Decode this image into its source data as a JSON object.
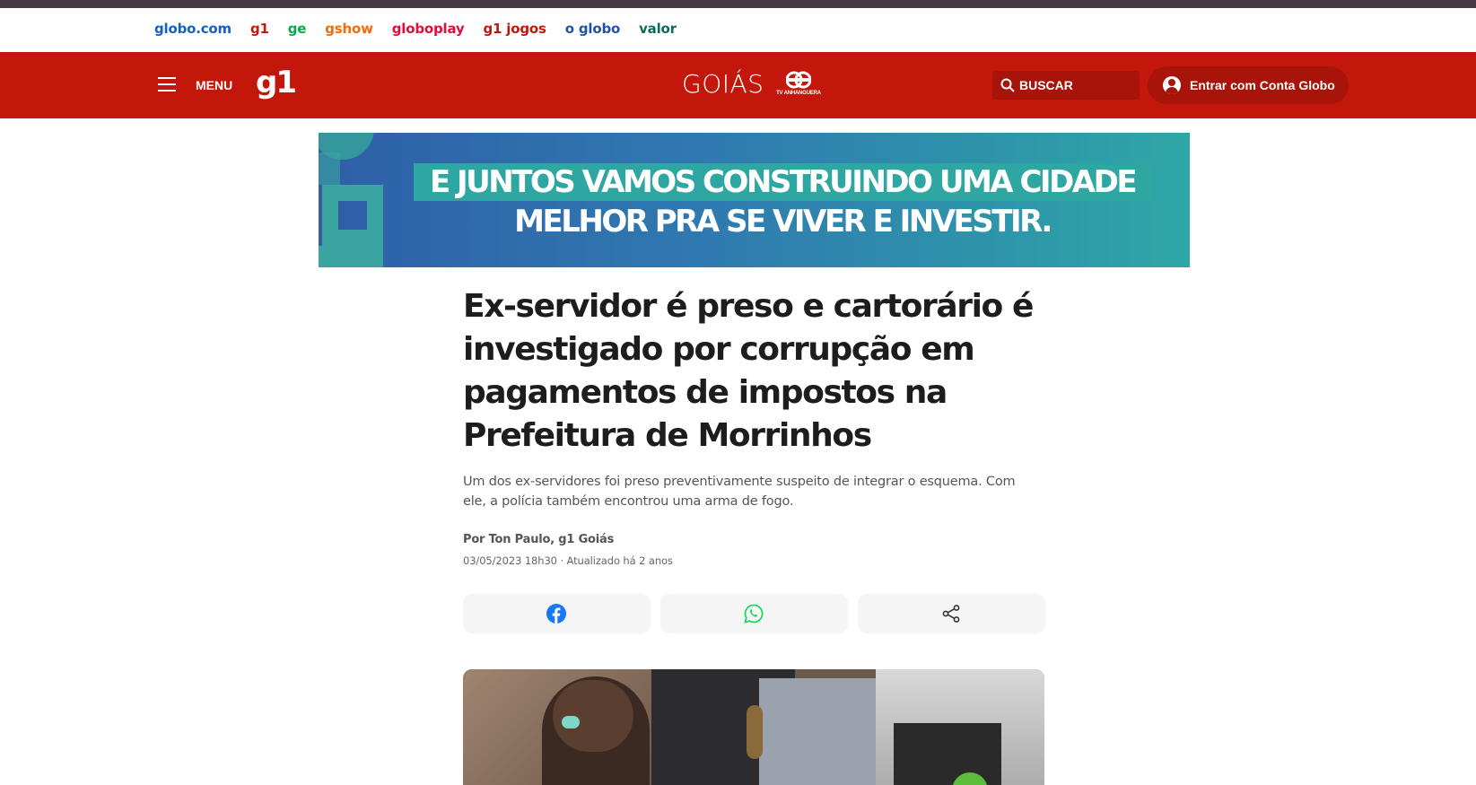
{
  "network_bar": {
    "links": [
      {
        "label": "globo.com",
        "color": "#1560c0"
      },
      {
        "label": "g1",
        "color": "#c4170c"
      },
      {
        "label": "ge",
        "color": "#06aa48"
      },
      {
        "label": "gshow",
        "color": "#f56b09"
      },
      {
        "label": "globoplay",
        "color": "#e40c3b"
      },
      {
        "label": "g1 jogos",
        "color": "#c4170c"
      },
      {
        "label": "o globo",
        "color": "#2152a3"
      },
      {
        "label": "valor",
        "color": "#0f6a5a"
      }
    ]
  },
  "header": {
    "menu_label": "MENU",
    "logo": "g1",
    "region": "GOIÁS",
    "affiliate": "TV ANHANGUERA",
    "search_label": "BUSCAR",
    "login_label": "Entrar com Conta Globo",
    "brand_color": "#c4170c"
  },
  "ad_banner": {
    "line1": "E JUNTOS VAMOS CONSTRUINDO UMA CIDADE",
    "line2": "MELHOR PRA SE VIVER E INVESTIR."
  },
  "article": {
    "title": "Ex-servidor é preso e cartorário é investigado por corrupção em pagamentos de impostos na Prefeitura de Morrinhos",
    "subtitle": "Um dos ex-servidores foi preso preventivamente suspeito de integrar o esquema. Com ele, a polícia também encontrou uma arma de fogo.",
    "author": "Por Ton Paulo, g1 Goiás",
    "date": "03/05/2023 18h30 · Atualizado há 2 anos"
  },
  "share": {
    "icons": [
      "facebook-icon",
      "whatsapp-icon",
      "share-icon"
    ],
    "facebook_color": "#1877f2",
    "whatsapp_color": "#25d366"
  }
}
